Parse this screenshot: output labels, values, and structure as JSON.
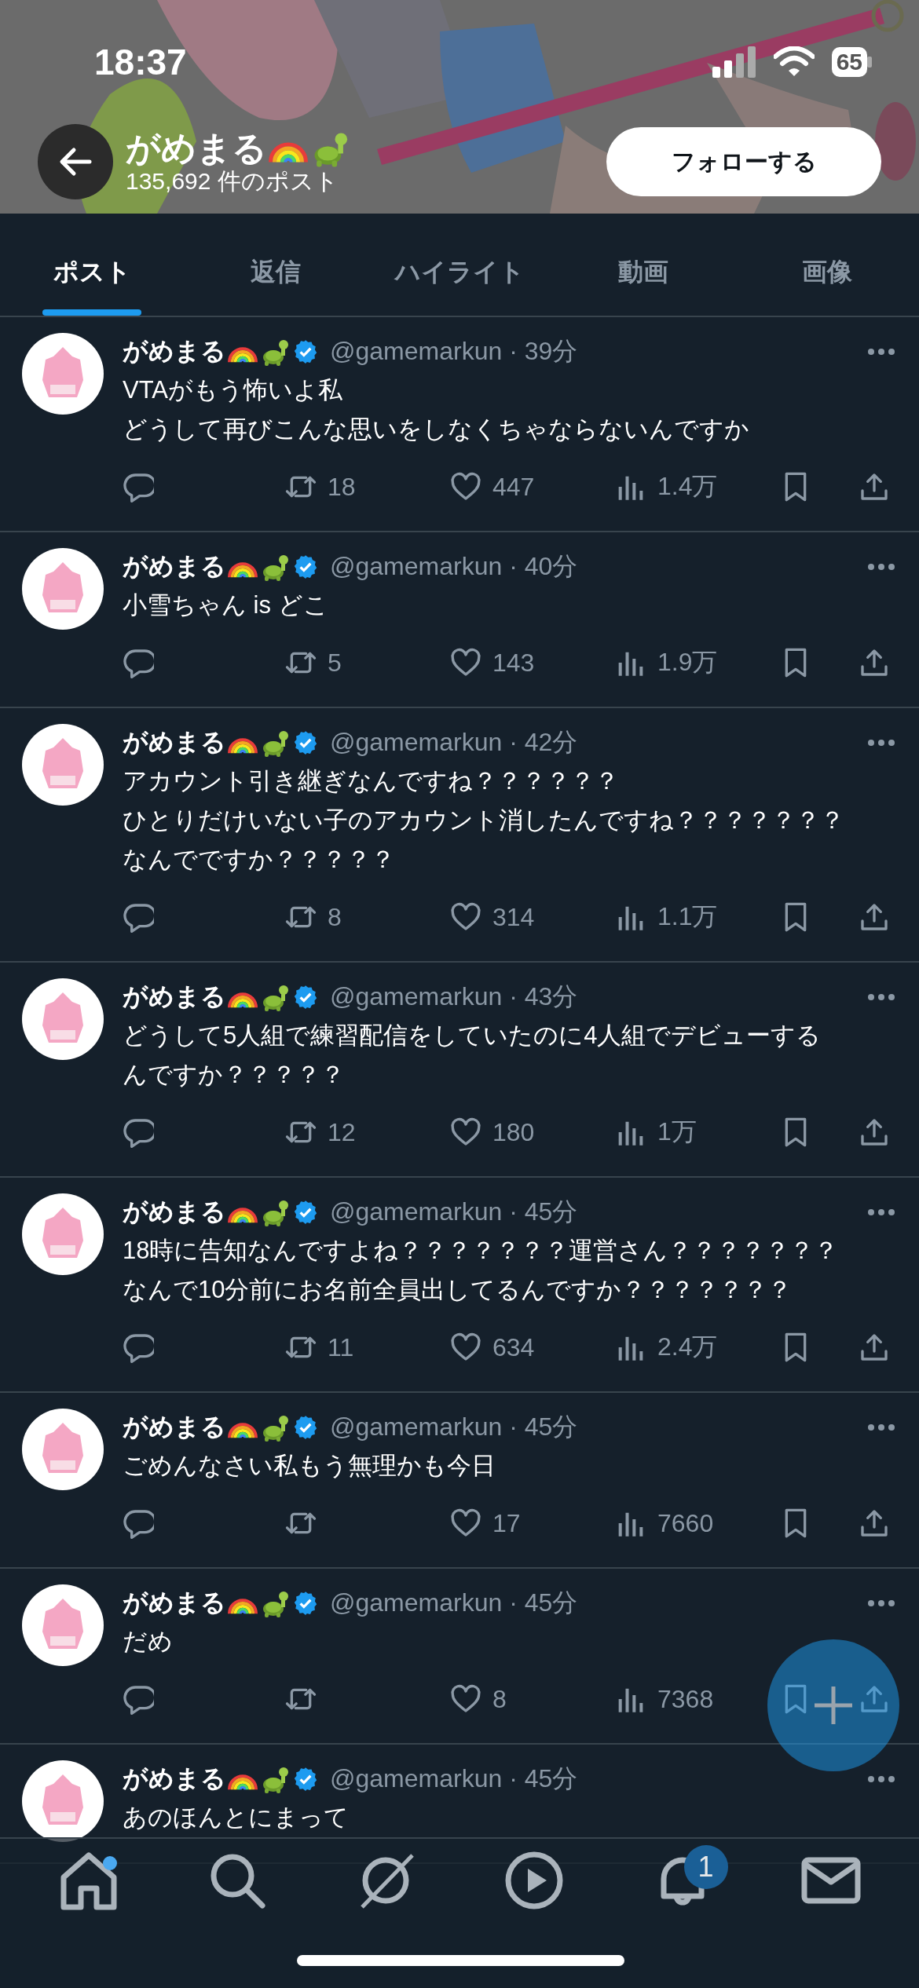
{
  "status_bar": {
    "time": "18:37",
    "battery": "65"
  },
  "header": {
    "name": "がめまる",
    "post_count": "135,692 件のポスト",
    "follow_button": "フォローする"
  },
  "tabs": [
    {
      "label": "ポスト",
      "selected": true
    },
    {
      "label": "返信",
      "selected": false
    },
    {
      "label": "ハイライト",
      "selected": false
    },
    {
      "label": "動画",
      "selected": false
    },
    {
      "label": "画像",
      "selected": false
    }
  ],
  "posts": [
    {
      "name": "がめまる",
      "meta": "@gamemarkun · 39分",
      "text": [
        "VTAがもう怖いよ私",
        "どうして再びこんな思いをしなくちゃならないんですか"
      ],
      "retweets": "18",
      "likes": "447",
      "views": "1.4万"
    },
    {
      "name": "がめまる",
      "meta": "@gamemarkun · 40分",
      "text": [
        "小雪ちゃん is どこ"
      ],
      "retweets": "5",
      "likes": "143",
      "views": "1.9万"
    },
    {
      "name": "がめまる",
      "meta": "@gamemarkun · 42分",
      "text": [
        "アカウント引き継ぎなんですね？？？？？？",
        "ひとりだけいない子のアカウント消したんですね？？？？？？？",
        "なんでですか？？？？？"
      ],
      "retweets": "8",
      "likes": "314",
      "views": "1.1万"
    },
    {
      "name": "がめまる",
      "meta": "@gamemarkun · 43分",
      "text": [
        "どうして5人組で練習配信をしていたのに4人組でデビューするんですか？？？？？"
      ],
      "retweets": "12",
      "likes": "180",
      "views": "1万"
    },
    {
      "name": "がめまる",
      "meta": "@gamemarkun · 45分",
      "text": [
        "18時に告知なんですよね？？？？？？？運営さん？？？？？？？",
        "なんで10分前にお名前全員出してるんですか？？？？？？？"
      ],
      "retweets": "11",
      "likes": "634",
      "views": "2.4万"
    },
    {
      "name": "がめまる",
      "meta": "@gamemarkun · 45分",
      "text": [
        "ごめんなさい私もう無理かも今日"
      ],
      "likes": "17",
      "views": "7660"
    },
    {
      "name": "がめまる",
      "meta": "@gamemarkun · 45分",
      "text": [
        "だめ"
      ],
      "likes": "8",
      "views": "7368"
    },
    {
      "name": "がめまる",
      "meta": "@gamemarkun · 45分",
      "text": [
        "あのほんとにまって"
      ]
    }
  ],
  "nav": {
    "notification_badge": "1"
  }
}
